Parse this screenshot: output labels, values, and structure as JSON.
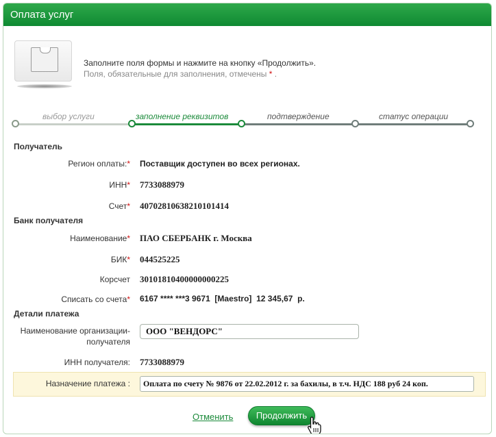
{
  "header": {
    "title": "Оплата услуг"
  },
  "intro": {
    "line1": "Заполните поля формы и нажмите на кнопку «Продолжить».",
    "line2_prefix": "Поля, обязательные для заполнения, отмечены",
    "line2_star": "*",
    "line2_suffix": "."
  },
  "steps": [
    {
      "label": "выбор услуги",
      "state": "done"
    },
    {
      "label": "заполнение реквизитов",
      "state": "active"
    },
    {
      "label": "подтверждение",
      "state": "future"
    },
    {
      "label": "статус операции",
      "state": "future"
    }
  ],
  "recipient": {
    "title": "Получатель",
    "region_label": "Регион оплаты:",
    "region_value": "Поставщик доступен во всех регионах.",
    "inn_label": "ИНН",
    "inn_value": "7733088979",
    "account_label": "Счет",
    "account_value": "40702810638210101414"
  },
  "bank": {
    "title": "Банк получателя",
    "name_label": "Наименование",
    "name_value": "ПАО СБЕРБАНК г. Москва",
    "bik_label": "БИК",
    "bik_value": "044525225",
    "corr_label": "Корсчет",
    "corr_value": "30101810400000000225",
    "debit_label": "Списать со счета",
    "debit_value": "6167 **** ***3 9671  [Maestro]  12 345,67  р."
  },
  "details": {
    "title": "Детали платежа",
    "org_label_line1": "Наименование организации-",
    "org_label_line2": "получателя",
    "org_value": "ООО \"ВЕНДОРС\"",
    "inn_label": "ИНН получателя:",
    "inn_value": "7733088979",
    "purpose_label": "Назначение платежа :",
    "purpose_value": "Оплата по счету № 9876 от 22.02.2012 г. за бахилы, в т.ч. НДС 188 руб 24 коп."
  },
  "actions": {
    "cancel_label": "Отменить",
    "continue_label": "Продолжить"
  },
  "required_star": "*",
  "colors": {
    "brand_green": "#1b8a3a",
    "required_red": "#d01010",
    "highlight_row": "#fdf7dc"
  }
}
